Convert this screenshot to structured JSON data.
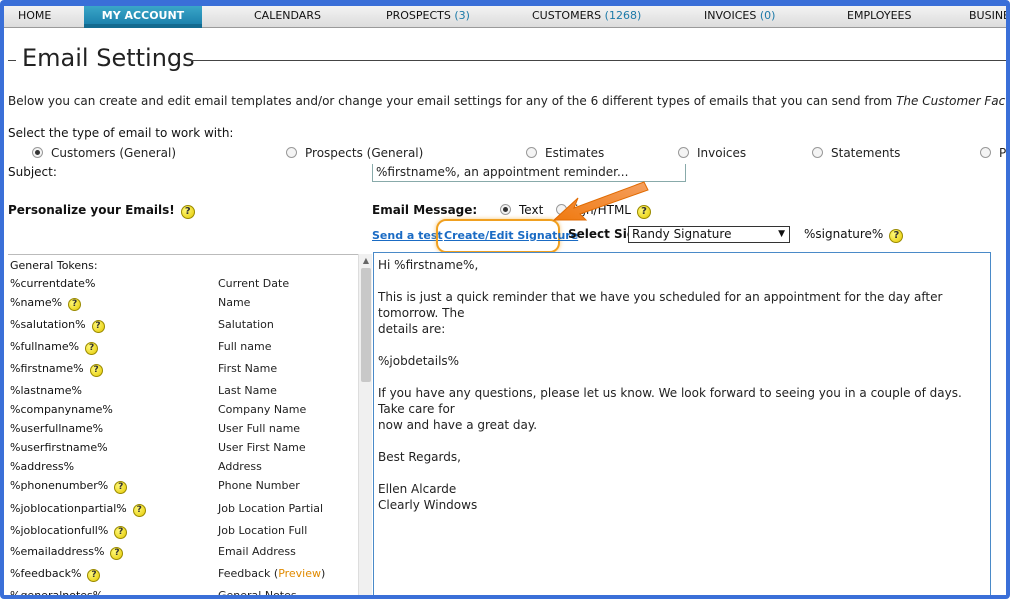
{
  "nav": {
    "home": "HOME",
    "my_account": "MY ACCOUNT",
    "calendars": "CALENDARS",
    "prospects": "PROSPECTS",
    "prospects_count": "(3)",
    "customers": "CUSTOMERS",
    "customers_count": "(1268)",
    "invoices": "INVOICES",
    "invoices_count": "(0)",
    "employees": "EMPLOYEES",
    "business": "BUSINES"
  },
  "page_title": "Email Settings",
  "intro_text": "Below you can create and edit email templates and/or change your email settings for any of the 6 different types of emails that you can send from",
  "intro_brand": "The Customer Factor",
  "intro_end": ".",
  "select_type_label": "Select the type of email to work with:",
  "email_types": [
    {
      "label": "Customers",
      "sub": "(General)",
      "selected": true
    },
    {
      "label": "Prospects (General)",
      "selected": false
    },
    {
      "label": "Estimates",
      "selected": false
    },
    {
      "label": "Invoices",
      "selected": false
    },
    {
      "label": "Statements",
      "selected": false
    },
    {
      "label": "Pa",
      "selected": false
    }
  ],
  "subject_label": "Subject:",
  "subject_value": "%firstname%, an appointment reminder...",
  "personalize_label": "Personalize your Emails!",
  "help_glyph": "?",
  "email_message_label": "Email Message:",
  "format_text": "Text",
  "format_html": "Design/HTML",
  "format_html_visible": "ign/HTML",
  "send_test": "Send a test",
  "create_edit_signature": "Create/Edit Signature",
  "select_sig_label": "Select Sig:",
  "selected_signature": "Randy Signature",
  "signature_token": "%signature%",
  "tokens_header": "General Tokens:",
  "tokens": [
    {
      "name": "%currentdate%",
      "desc": "Current Date",
      "help": false
    },
    {
      "name": "%name%",
      "desc": "Name",
      "help": true
    },
    {
      "name": "%salutation%",
      "desc": "Salutation",
      "help": true
    },
    {
      "name": "%fullname%",
      "desc": "Full name",
      "help": true
    },
    {
      "name": "%firstname%",
      "desc": "First Name",
      "help": true
    },
    {
      "name": "%lastname%",
      "desc": "Last Name",
      "help": false
    },
    {
      "name": "%companyname%",
      "desc": "Company Name",
      "help": false
    },
    {
      "name": "%userfullname%",
      "desc": "User Full name",
      "help": false
    },
    {
      "name": "%userfirstname%",
      "desc": "User First Name",
      "help": false
    },
    {
      "name": "%address%",
      "desc": "Address",
      "help": false
    },
    {
      "name": "%phonenumber%",
      "desc": "Phone Number",
      "help": true
    },
    {
      "name": "%joblocationpartial%",
      "desc": "Job Location Partial",
      "help": true
    },
    {
      "name": "%joblocationfull%",
      "desc": "Job Location Full",
      "help": true
    },
    {
      "name": "%emailaddress%",
      "desc": "Email Address",
      "help": true
    },
    {
      "name": "%feedback%",
      "desc": "Feedback",
      "help": true,
      "preview": "Preview"
    },
    {
      "name": "%generalnotes%",
      "desc": "General Notes",
      "help": false
    }
  ],
  "message_lines": [
    "Hi %firstname%,",
    "",
    "This is just a quick reminder that we have you scheduled for an appointment for the day after tomorrow. The",
    "details are:",
    "",
    "%jobdetails%",
    "",
    "If you have any questions, please let us know. We look forward to seeing you in a couple of days. Take care for",
    "now and have a great day.",
    "",
    "Best Regards,",
    "",
    "Ellen Alcarde",
    "Clearly Windows"
  ]
}
